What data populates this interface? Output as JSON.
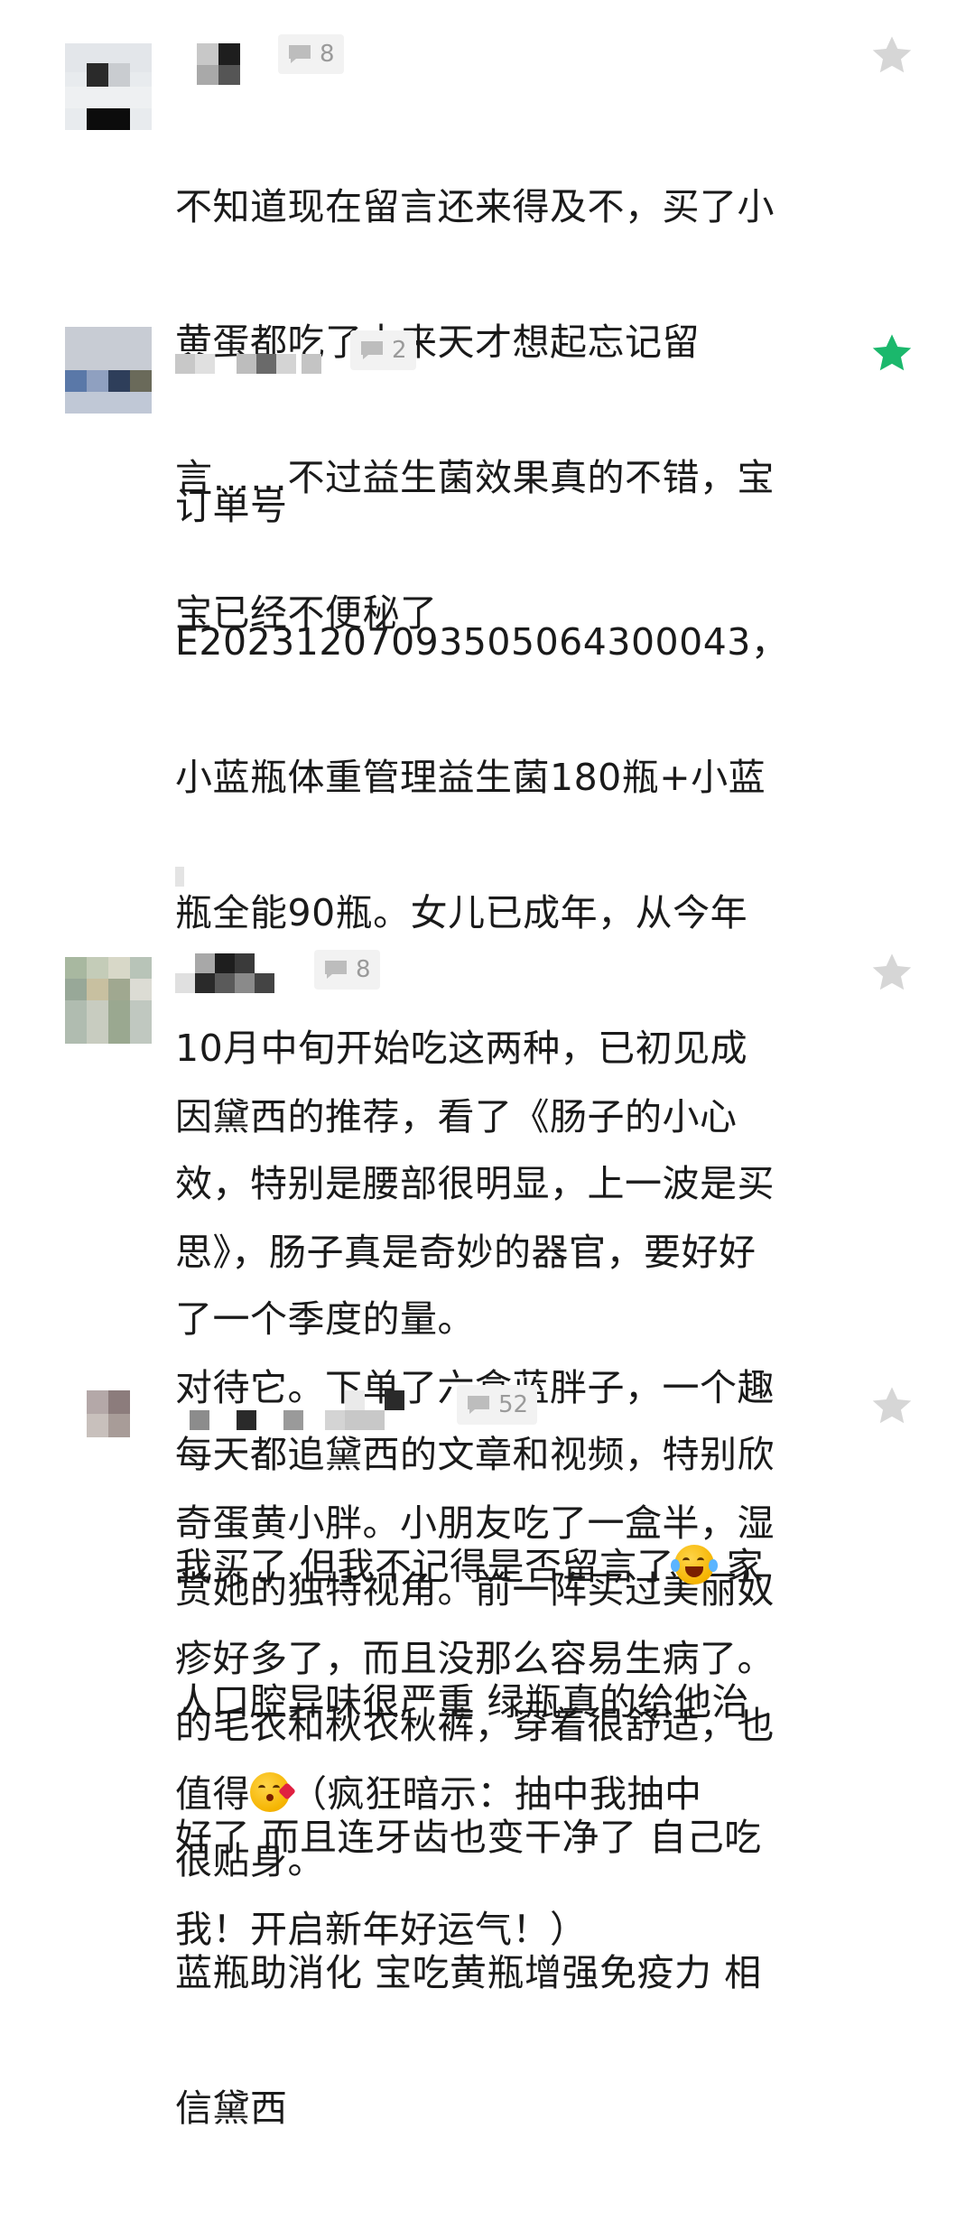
{
  "comments": [
    {
      "reply_count": "8",
      "starred": false,
      "lines": [
        "不知道现在留言还来得及不，买了小",
        "黄蛋都吃了十来天才想起忘记留",
        "言……不过益生菌效果真的不错，宝",
        "宝已经不便秘了"
      ]
    },
    {
      "reply_count": "2",
      "starred": true,
      "lines": [
        "订单号",
        "E202312070935050643000​43，",
        "小蓝瓶体重管理益生菌180瓶+小蓝",
        "瓶全能90瓶。女儿已成年，从今年",
        "10月中旬开始吃这两种，已初见成",
        "效，特别是腰部很明显，上一波是买",
        "了一个季度的量。",
        "每天都追黛西的文章和视频，特别欣",
        "赏她的独特视角。前一阵买过美丽奴",
        "的毛衣和秋衣秋裤，穿着很舒适，也",
        "很贴身。"
      ]
    },
    {
      "reply_count": "8",
      "starred": false,
      "lines": [
        "因黛西的推荐，看了《肠子的小心",
        "思》，肠子真是奇妙的器官，要好好",
        "对待它。下单了六盒蓝胖子，一个趣",
        "奇蛋黄小胖。小朋友吃了一盒半，湿",
        "疹好多了，而且没那么容易生病了。"
      ],
      "line6_before": "值得",
      "line6_after": "（疯狂暗示：抽中我抽中",
      "line7": "我！开启新年好运气！）"
    },
    {
      "reply_count": "52",
      "starred": false,
      "line1_before": "我买了 但我不记得是否留言了",
      "line1_after": " 家",
      "lines": [
        "人口腔异味很严重 绿瓶真的给他治",
        "好了 而且连牙齿也变干净了 自己吃",
        "蓝瓶助消化 宝吃黄瓶增强免疫力 相",
        "信黛西"
      ]
    }
  ],
  "colors": {
    "star_active": "#1bb86c",
    "star_inactive": "#d6d6d6",
    "text": "#1a1a1a",
    "meta": "#9a9a9a"
  },
  "icons": [
    "star-icon",
    "comment-bubble-icon",
    "kiss-emoji-icon",
    "laugh-cry-emoji-icon"
  ]
}
